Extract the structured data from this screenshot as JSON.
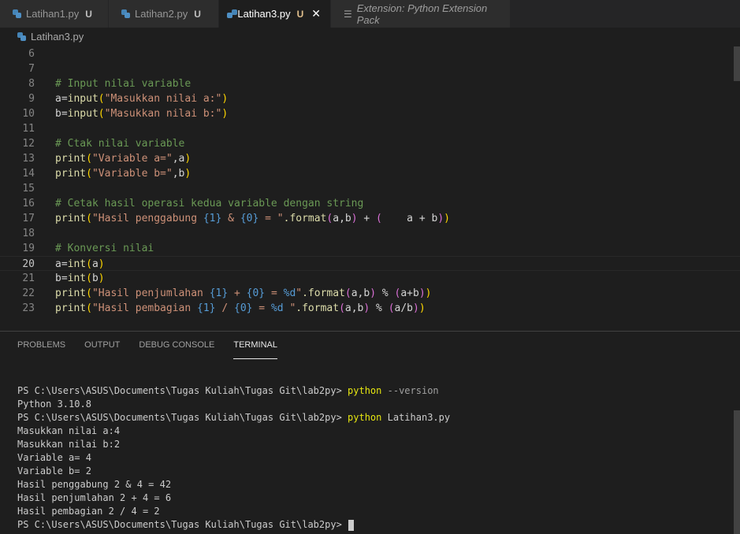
{
  "tabs": [
    {
      "label": "Latihan1.py",
      "status": "U"
    },
    {
      "label": "Latihan2.py",
      "status": "U"
    },
    {
      "label": "Latihan3.py",
      "status": "U",
      "close": "✕"
    },
    {
      "label": "Extension: Python Extension Pack"
    }
  ],
  "breadcrumb": {
    "file": "Latihan3.py"
  },
  "editor": {
    "line_numbers": [
      "6",
      "7",
      "8",
      "9",
      "10",
      "11",
      "12",
      "13",
      "14",
      "15",
      "16",
      "17",
      "18",
      "19",
      "20",
      "21",
      "22",
      "23"
    ],
    "current_line": "20"
  },
  "panel": {
    "tabs": [
      "PROBLEMS",
      "OUTPUT",
      "DEBUG CONSOLE",
      "TERMINAL"
    ],
    "active_tab": "TERMINAL"
  },
  "terminal": {
    "prompt": "PS C:\\Users\\ASUS\\Documents\\Tugas Kuliah\\Tugas Git\\lab2py> ",
    "cmd1": "python",
    "cmd1_arg": " --version",
    "out1": "Python 3.10.8",
    "cmd2": "python",
    "cmd2_arg": " Latihan3.py",
    "outputs": [
      "Masukkan nilai a:4",
      "Masukkan nilai b:2",
      "Variable a= 4",
      "Variable b= 2",
      "Hasil penggabung 2 & 4 = 42",
      "Hasil penjumlahan 2 + 4 = 6",
      "Hasil pembagian 2 / 4 = 2"
    ]
  },
  "code": {
    "l8": "# Input nilai variable",
    "l9_a": "a=",
    "l9_fn": "input",
    "l9_str": "\"Masukkan nilai a:\"",
    "l10_a": "b=",
    "l10_fn": "input",
    "l10_str": "\"Masukkan nilai b:\"",
    "l12": "# Ctak nilai variable",
    "l13_fn": "print",
    "l13_str": "\"Variable a=\"",
    "l13_rest": ",a",
    "l14_fn": "print",
    "l14_str": "\"Variable b=\"",
    "l14_rest": ",b",
    "l16": "# Cetak hasil operasi kedua variable dengan string",
    "l17_fn": "print",
    "l17_s1": "\"Hasil penggabung ",
    "l17_p1": "{1}",
    "l17_s2": " & ",
    "l17_p2": "{0}",
    "l17_s3": " = \"",
    "l17_fmt": ".format",
    "l17_args": "a,b",
    "l17_plus": " + ",
    "l17_inner": "    a + b",
    "l19": "# Konversi nilai",
    "l20_a": "a=",
    "l20_fn": "int",
    "l20_arg": "a",
    "l21_a": "b=",
    "l21_fn": "int",
    "l21_arg": "b",
    "l22_fn": "print",
    "l22_s1": "\"Hasil penjumlahan ",
    "l22_p1": "{1}",
    "l22_s2": " + ",
    "l22_p2": "{0}",
    "l22_s3": " = ",
    "l22_p3": "%d",
    "l22_s4": "\"",
    "l22_fmt": ".format",
    "l22_args": "a,b",
    "l22_mod": " % ",
    "l22_inner": "a+b",
    "l23_fn": "print",
    "l23_s1": "\"Hasil pembagian ",
    "l23_p1": "{1}",
    "l23_s2": " / ",
    "l23_p2": "{0}",
    "l23_s3": " = ",
    "l23_p3": "%d",
    "l23_s4": " \"",
    "l23_fmt": ".format",
    "l23_args": "a,b",
    "l23_mod": " % ",
    "l23_inner": "a/b"
  },
  "colors": {
    "background": "#1e1e1e",
    "comment": "#6a9955",
    "string": "#ce9178",
    "function": "#dcdcaa",
    "terminal_command": "#e5e510"
  }
}
